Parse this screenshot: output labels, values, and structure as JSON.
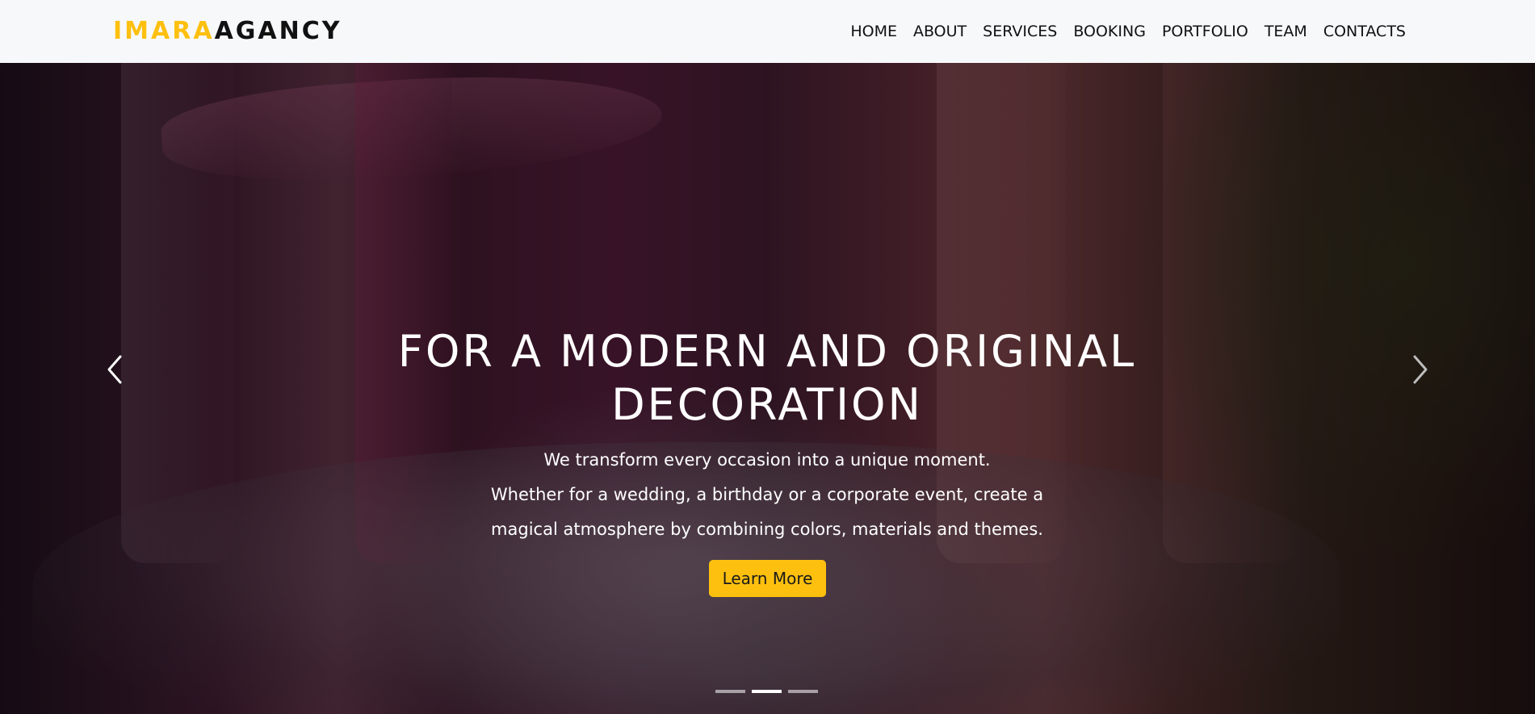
{
  "brand": {
    "part1": "IMARA",
    "part2": "AGANCY",
    "accent_color": "#fdc00f",
    "text_color": "#111111"
  },
  "nav": {
    "items": [
      {
        "label": "HOME"
      },
      {
        "label": "ABOUT"
      },
      {
        "label": "SERVICES"
      },
      {
        "label": "BOOKING"
      },
      {
        "label": "PORTFOLIO"
      },
      {
        "label": "TEAM"
      },
      {
        "label": "CONTACTS"
      }
    ]
  },
  "hero": {
    "title": "FOR A MODERN AND ORIGINAL DECORATION",
    "lines": [
      "We transform every occasion into a unique moment.",
      "Whether for a wedding, a birthday or a corporate event, create a",
      "magical atmosphere by combining colors, materials and themes."
    ],
    "button_label": "Learn More",
    "button_color": "#fdc00f",
    "prev_icon": "chevron-left-icon",
    "next_icon": "chevron-right-icon",
    "slides": {
      "count": 3,
      "active_index": 1
    }
  }
}
